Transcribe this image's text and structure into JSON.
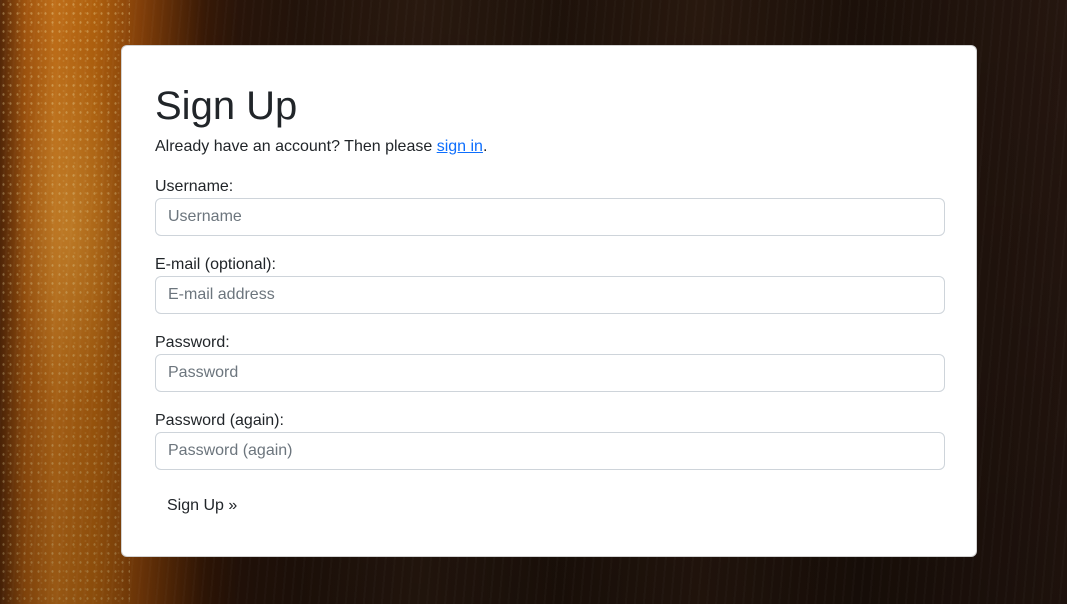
{
  "form": {
    "title": "Sign Up",
    "intro_text": "Already have an account? Then please ",
    "signin_link": "sign in",
    "intro_suffix": ".",
    "fields": [
      {
        "label": "Username:",
        "placeholder": "Username",
        "value": ""
      },
      {
        "label": "E-mail (optional):",
        "placeholder": "E-mail address",
        "value": ""
      },
      {
        "label": "Password:",
        "placeholder": "Password",
        "value": ""
      },
      {
        "label": "Password (again):",
        "placeholder": "Password (again)",
        "value": ""
      }
    ],
    "submit_label": "Sign Up »"
  },
  "colors": {
    "link": "#0d6efd",
    "input_border": "#ced4da",
    "placeholder": "#6c757d"
  }
}
